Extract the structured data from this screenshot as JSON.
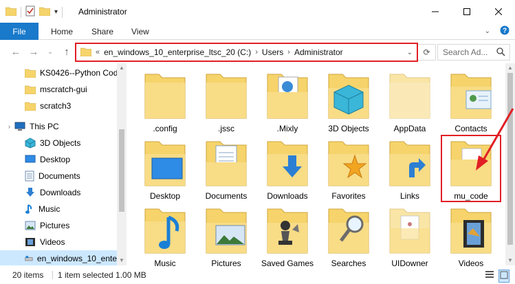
{
  "window": {
    "title": "Administrator",
    "minimize_icon": "minimize-icon",
    "maximize_icon": "maximize-icon",
    "close_icon": "close-icon"
  },
  "ribbon": {
    "file": "File",
    "home": "Home",
    "share": "Share",
    "view": "View"
  },
  "address": {
    "chevron_left": "«",
    "crumbs": [
      "en_windows_10_enterprise_ltsc_20 (C:)",
      "Users",
      "Administrator"
    ],
    "search_placeholder": "Search Ad..."
  },
  "navpane": {
    "items": [
      {
        "label": "KS0426--Python Cod",
        "icon": "folder-icon"
      },
      {
        "label": "mscratch-gui",
        "icon": "folder-icon"
      },
      {
        "label": "scratch3",
        "icon": "folder-icon"
      },
      {
        "label": "This PC",
        "icon": "computer-icon"
      },
      {
        "label": "3D Objects",
        "icon": "3d-objects-icon"
      },
      {
        "label": "Desktop",
        "icon": "desktop-icon"
      },
      {
        "label": "Documents",
        "icon": "documents-icon"
      },
      {
        "label": "Downloads",
        "icon": "downloads-icon"
      },
      {
        "label": "Music",
        "icon": "music-icon"
      },
      {
        "label": "Pictures",
        "icon": "pictures-icon"
      },
      {
        "label": "Videos",
        "icon": "videos-icon"
      },
      {
        "label": "en_windows_10_ente",
        "icon": "drive-icon"
      }
    ]
  },
  "content": {
    "items": [
      {
        "label": ".config"
      },
      {
        "label": ".jssc"
      },
      {
        "label": ".Mixly"
      },
      {
        "label": "3D Objects"
      },
      {
        "label": "AppData"
      },
      {
        "label": "Contacts"
      },
      {
        "label": "Desktop"
      },
      {
        "label": "Documents"
      },
      {
        "label": "Downloads"
      },
      {
        "label": "Favorites"
      },
      {
        "label": "Links"
      },
      {
        "label": "mu_code"
      },
      {
        "label": "Music"
      },
      {
        "label": "Pictures"
      },
      {
        "label": "Saved Games"
      },
      {
        "label": "Searches"
      },
      {
        "label": "UIDowner"
      },
      {
        "label": "Videos"
      }
    ]
  },
  "status": {
    "items_count": "20 items",
    "selection": "1 item selected  1.00 MB"
  },
  "colors": {
    "accent": "#1979ca",
    "highlight": "#e21e25",
    "folder": "#f6d46b",
    "nav_selected": "#cce8ff"
  }
}
